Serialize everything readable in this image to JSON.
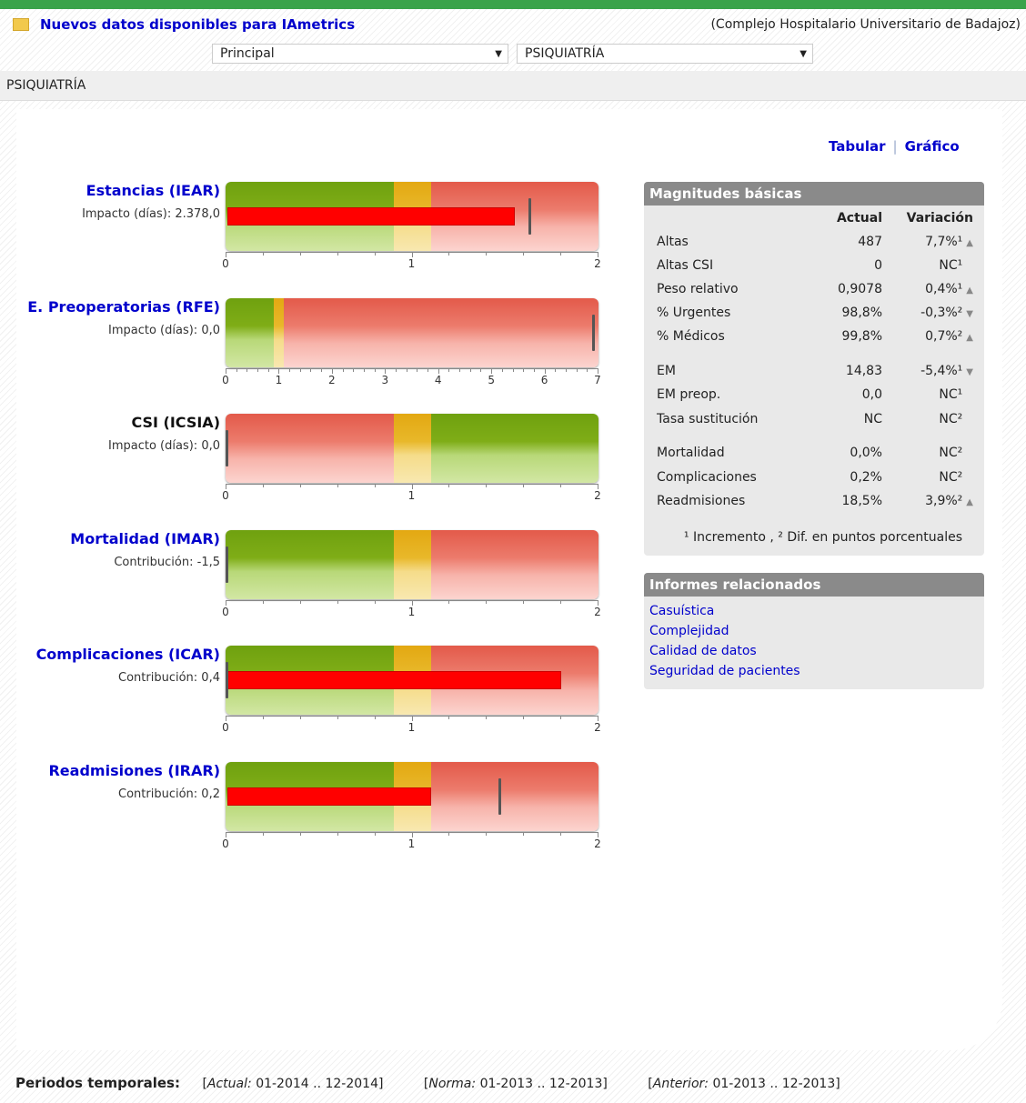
{
  "header": {
    "news_link": "Nuevos datos disponibles para IAmetrics",
    "hospital": "(Complejo Hospitalario Universitario de Badajoz)",
    "select_view": "Principal",
    "select_service": "PSIQUIATRÍA",
    "section_title": "PSIQUIATRÍA"
  },
  "view_links": {
    "tabular": "Tabular",
    "separator": "|",
    "grafico": "Gráfico"
  },
  "indicators": [
    {
      "title": "Estancias (IEAR)",
      "subtitle": "Impacto (días): 2.378,0",
      "value": 1.55,
      "reference": 1.63,
      "axis_max": 2,
      "ticks": [
        "0",
        "1",
        "2"
      ],
      "zones": "green-yellow-red",
      "link": true
    },
    {
      "title": "E. Preoperatorias (RFE)",
      "subtitle": "Impacto (días): 0,0",
      "value": null,
      "reference": 6.9,
      "axis_max": 7,
      "ticks": [
        "0",
        "1",
        "2",
        "3",
        "4",
        "5",
        "6",
        "7"
      ],
      "zones": "green-yellow-red",
      "link": true
    },
    {
      "title": "CSI (ICSIA)",
      "subtitle": "Impacto (días): 0,0",
      "value": null,
      "reference": 0,
      "axis_max": 2,
      "ticks": [
        "0",
        "1",
        "2"
      ],
      "zones": "red-yellow-green",
      "link": false
    },
    {
      "title": "Mortalidad (IMAR)",
      "subtitle": "Contribución: -1,5",
      "value": null,
      "reference": 0,
      "axis_max": 2,
      "ticks": [
        "0",
        "1",
        "2"
      ],
      "zones": "green-yellow-red",
      "link": true
    },
    {
      "title": "Complicaciones (ICAR)",
      "subtitle": "Contribución:  0,4",
      "value": 1.8,
      "reference": 0,
      "axis_max": 2,
      "ticks": [
        "0",
        "1",
        "2"
      ],
      "zones": "green-yellow-red",
      "link": true
    },
    {
      "title": "Readmisiones (IRAR)",
      "subtitle": "Contribución:  0,2",
      "value": 1.1,
      "reference": 1.47,
      "axis_max": 2,
      "ticks": [
        "0",
        "1",
        "2"
      ],
      "zones": "green-yellow-red",
      "link": true
    }
  ],
  "magnitudes": {
    "title": "Magnitudes básicas",
    "col_actual": "Actual",
    "col_variacion": "Variación",
    "rows": [
      {
        "label": "Altas",
        "actual": "487",
        "var": "7,7%¹",
        "trend": "▲"
      },
      {
        "label": "Altas CSI",
        "actual": "0",
        "var": "NC¹",
        "trend": ""
      },
      {
        "label": "Peso relativo",
        "actual": "0,9078",
        "var": "0,4%¹",
        "trend": "▲"
      },
      {
        "label": "% Urgentes",
        "actual": "98,8%",
        "var": "-0,3%²",
        "trend": "▼"
      },
      {
        "label": "% Médicos",
        "actual": "99,8%",
        "var": "0,7%²",
        "trend": "▲"
      },
      {
        "label": "EM",
        "actual": "14,83",
        "var": "-5,4%¹",
        "trend": "▼"
      },
      {
        "label": "EM preop.",
        "actual": "0,0",
        "var": "NC¹",
        "trend": ""
      },
      {
        "label": "Tasa sustitución",
        "actual": "NC",
        "var": "NC²",
        "trend": ""
      },
      {
        "label": "Mortalidad",
        "actual": "0,0%",
        "var": "NC²",
        "trend": ""
      },
      {
        "label": "Complicaciones",
        "actual": "0,2%",
        "var": "NC²",
        "trend": ""
      },
      {
        "label": "Readmisiones",
        "actual": "18,5%",
        "var": "3,9%²",
        "trend": "▲"
      }
    ],
    "footnote": "¹ Incremento , ² Dif. en puntos porcentuales"
  },
  "related": {
    "title": "Informes relacionados",
    "links": [
      "Casuística",
      "Complejidad",
      "Calidad de datos",
      "Seguridad de pacientes"
    ]
  },
  "periods": {
    "label": "Periodos temporales:",
    "actual_label": "Actual:",
    "actual_value": "01-2014 .. 12-2014",
    "norma_label": "Norma:",
    "norma_value": "01-2013 .. 12-2013",
    "anterior_label": "Anterior:",
    "anterior_value": "01-2013 .. 12-2013"
  }
}
